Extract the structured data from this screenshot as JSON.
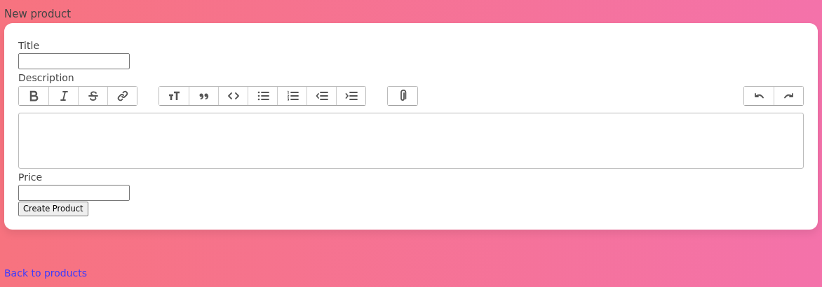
{
  "heading": "New product",
  "form": {
    "fields": [
      {
        "kind": "text",
        "label": "Title"
      },
      {
        "kind": "rich",
        "label": "Description",
        "toolbar": [
          {
            "tools": [
              {
                "kind": "bold"
              },
              {
                "kind": "italic"
              },
              {
                "kind": "strike"
              },
              {
                "kind": "link"
              }
            ]
          },
          {
            "tools": [
              {
                "kind": "heading"
              },
              {
                "kind": "quote"
              },
              {
                "kind": "code"
              },
              {
                "kind": "bullets"
              },
              {
                "kind": "numbers"
              },
              {
                "kind": "outdent"
              },
              {
                "kind": "indent"
              }
            ]
          },
          {
            "tools": [
              {
                "kind": "attach"
              }
            ]
          },
          {
            "tools": [
              {
                "kind": "undo"
              },
              {
                "kind": "redo"
              }
            ]
          }
        ]
      },
      {
        "kind": "text",
        "label": "Price"
      }
    ],
    "submit": "Create Product"
  },
  "back_link": "Back to products"
}
